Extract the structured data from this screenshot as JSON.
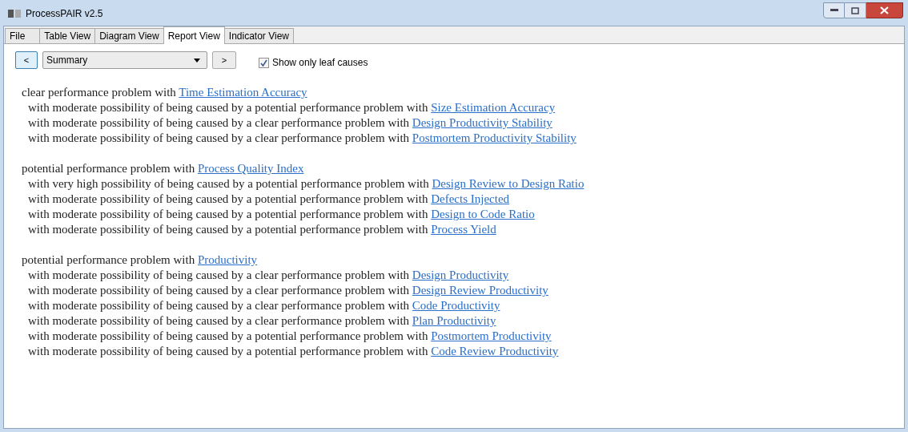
{
  "window": {
    "title": "ProcessPAIR v2.5"
  },
  "tabs": [
    {
      "label": "File",
      "selected": false
    },
    {
      "label": "Table View",
      "selected": false
    },
    {
      "label": "Diagram View",
      "selected": false
    },
    {
      "label": "Report View",
      "selected": true
    },
    {
      "label": "Indicator View",
      "selected": false
    }
  ],
  "toolbar": {
    "prev_button": "<",
    "dropdown": "Summary",
    "next_button": ">",
    "checkbox": {
      "label": "Show only leaf causes",
      "checked": true
    }
  },
  "report": [
    {
      "text": "clear performance problem with ",
      "link": "Time Estimation Accuracy",
      "causes": [
        {
          "text": "with moderate possibility of being caused by a potential performance problem with ",
          "link": "Size Estimation Accuracy"
        },
        {
          "text": "with moderate possibility of being caused by a clear performance problem with ",
          "link": "Design Productivity Stability"
        },
        {
          "text": "with moderate possibility of being caused by a clear performance problem with ",
          "link": "Postmortem Productivity Stability"
        }
      ]
    },
    {
      "text": "potential performance problem with ",
      "link": "Process Quality Index",
      "causes": [
        {
          "text": "with very high possibility of being caused by a potential performance problem with ",
          "link": "Design Review to Design Ratio"
        },
        {
          "text": "with moderate possibility of being caused by a potential performance problem with ",
          "link": "Defects Injected"
        },
        {
          "text": "with moderate possibility of being caused by a potential performance problem with ",
          "link": "Design to Code Ratio"
        },
        {
          "text": "with moderate possibility of being caused by a potential performance problem with ",
          "link": "Process Yield"
        }
      ]
    },
    {
      "text": "potential performance problem with ",
      "link": "Productivity",
      "causes": [
        {
          "text": "with moderate possibility of being caused by a clear performance problem with ",
          "link": "Design Productivity"
        },
        {
          "text": "with moderate possibility of being caused by a clear performance problem with ",
          "link": "Design Review Productivity"
        },
        {
          "text": "with moderate possibility of being caused by a clear performance problem with ",
          "link": "Code Productivity"
        },
        {
          "text": "with moderate possibility of being caused by a clear performance problem with ",
          "link": "Plan Productivity"
        },
        {
          "text": "with moderate possibility of being caused by a potential performance problem with ",
          "link": "Postmortem Productivity"
        },
        {
          "text": "with moderate possibility of being caused by a potential performance problem with ",
          "link": "Code Review Productivity"
        }
      ]
    }
  ]
}
